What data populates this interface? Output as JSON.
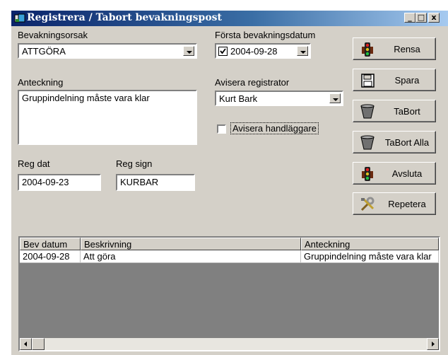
{
  "window": {
    "title": "Registrera / Tabort bevakningspost",
    "min": "_",
    "max": "□",
    "close": "x"
  },
  "form": {
    "bevakningsorsak_label": "Bevakningsorsak",
    "bevakningsorsak_value": "ATTGÖRA",
    "forsta_label": "Första bevakningsdatum",
    "forsta_value": "2004-09-28",
    "forsta_checked": true,
    "anteckning_label": "Anteckning",
    "anteckning_value": "Gruppindelning måste vara klar",
    "avisera_reg_label": "Avisera registrator",
    "avisera_reg_value": "Kurt Bark",
    "avisera_handl_label": "Avisera handläggare",
    "regdat_label": "Reg dat",
    "regdat_value": "2004-09-23",
    "regsign_label": "Reg sign",
    "regsign_value": "KURBAR"
  },
  "buttons": {
    "rensa": "Rensa",
    "spara": "Spara",
    "tabort": "TaBort",
    "tabort_alla": "TaBort Alla",
    "avsluta": "Avsluta",
    "repetera": "Repetera"
  },
  "grid": {
    "headers": [
      "Bev datum",
      "Beskrivning",
      "Anteckning"
    ],
    "rows": [
      [
        "2004-09-28",
        "Att göra",
        "Gruppindelning måste vara klar"
      ]
    ]
  },
  "colors": {
    "titlebar": "#0a246a",
    "face": "#d4d0c8",
    "grid_bg": "#808080"
  }
}
